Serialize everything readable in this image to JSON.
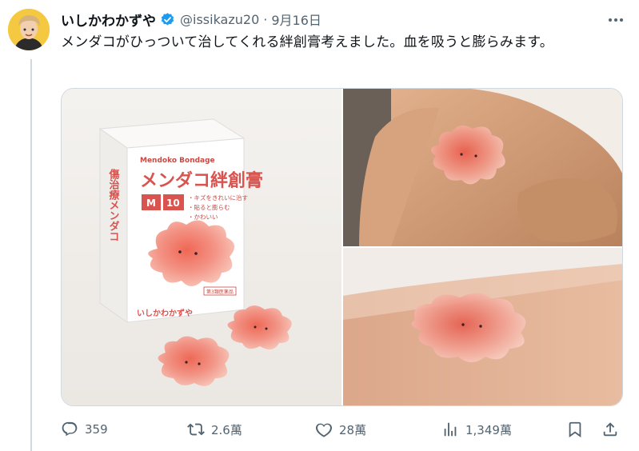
{
  "tweet": {
    "author_name": "いしかわかずや",
    "handle": "@issikazu20",
    "separator": "·",
    "date": "9月16日",
    "text": "メンダコがひっついて治してくれる絆創膏考えました。血を吸うと膨らみます。"
  },
  "product_box": {
    "brand_en": "Mendoko Bondage",
    "title": "メンダコ絆創膏",
    "size_tags": [
      "M",
      "10"
    ],
    "bullets": [
      "・キズをきれいに治す",
      "・貼ると膨らむ",
      "・かわいい"
    ],
    "maker": "いしかわかずや",
    "side_text": "傷治療メンダコ",
    "badge": "第3類医薬品"
  },
  "actions": {
    "reply_count": "359",
    "retweet_count": "2.6萬",
    "like_count": "28萬",
    "view_count": "1,349萬"
  },
  "icons": {
    "verified": "verified-badge-icon",
    "more": "more-options-icon",
    "reply": "reply-icon",
    "retweet": "retweet-icon",
    "like": "heart-icon",
    "views": "views-chart-icon",
    "bookmark": "bookmark-icon",
    "share": "share-icon"
  },
  "colors": {
    "verified_blue": "#1d9bf0",
    "secondary_text": "#536471",
    "box_red": "#d9534f",
    "jelly_pink": "#f08f84"
  }
}
